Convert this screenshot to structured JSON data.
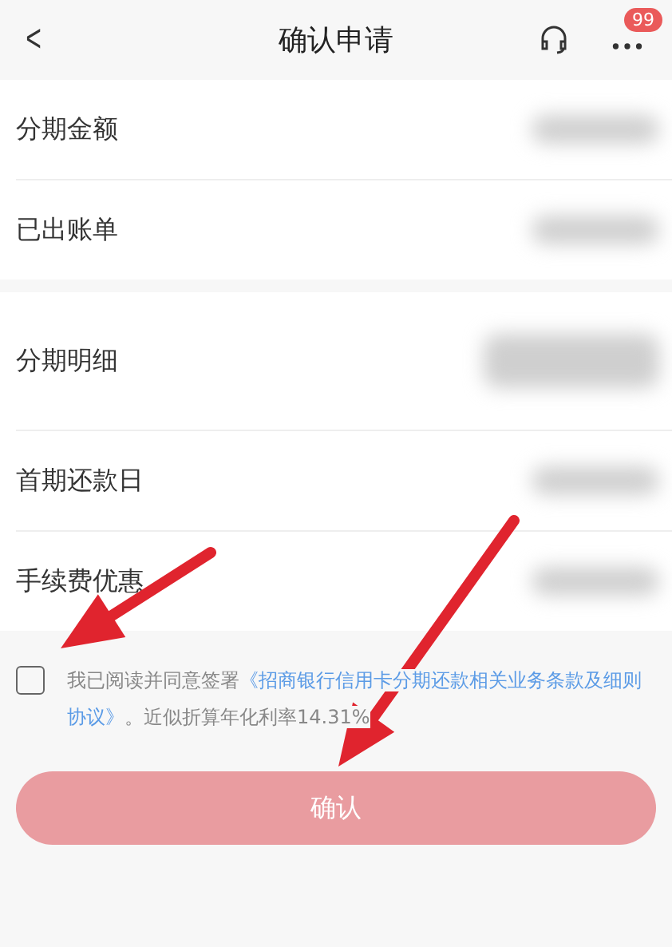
{
  "header": {
    "back_icon": "<",
    "title": "确认申请",
    "badge": "99"
  },
  "groups": [
    [
      {
        "label": "分期金额",
        "blurred": true,
        "tall": false
      },
      {
        "label": "已出账单",
        "blurred": true,
        "tall": false
      }
    ],
    [
      {
        "label": "分期明细",
        "blurred": true,
        "tall": true
      },
      {
        "label": "首期还款日",
        "blurred": true,
        "tall": false
      },
      {
        "label": "手续费优惠",
        "blurred": true,
        "tall": false
      }
    ]
  ],
  "agreement": {
    "checked": false,
    "prefix": "我已阅读并同意签署",
    "link": "《招商银行信用卡分期还款相关业务条款及细则协议》",
    "suffix": "。近似折算年化利率14.31%"
  },
  "confirm_button": {
    "label": "确认",
    "disabled": true
  },
  "annotations": [
    {
      "kind": "arrow"
    },
    {
      "kind": "arrow"
    }
  ]
}
